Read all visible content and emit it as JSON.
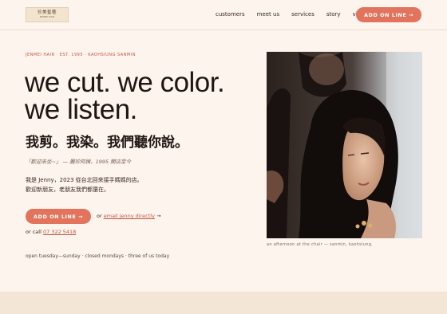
{
  "nav": {
    "logo_main": "珍美髮藝",
    "logo_sub": "JENMEI HAIR",
    "links": [
      "customers",
      "meet us",
      "services",
      "story",
      "visit"
    ],
    "cta_label": "ADD ON LINE →"
  },
  "hero": {
    "eyebrow": "JENMEI HAIR · EST. 1995 · KAOHSIUNG SANMIN",
    "headline_line1": "we cut. we color.",
    "headline_line2": "we listen.",
    "zh_headline": "我剪。我染。我們聽你說。",
    "quote": "「歡迎來坐~」 — 麗珍阿姨，1995 開店至今",
    "intro_line1": "我是 Jenny，2023 從台北回來接手媽媽的店。",
    "intro_line2": "歡迎新朋友，老朋友我們都還在。",
    "cta_label": "ADD ON LINE →",
    "or_text": "or",
    "email_link": "email jenny directly",
    "email_arrow": "→",
    "call_text": "or call",
    "phone": "07 322 5418",
    "hours": "open tuesday—sunday · closed mondays · three of us today"
  },
  "photo": {
    "caption": "an afternoon at the chair — sanmin, kaohsiung."
  },
  "colors": {
    "accent": "#e2735c",
    "background": "#fdf4ee",
    "footer_band": "#f3e6d6",
    "eyebrow": "#c0563f"
  }
}
